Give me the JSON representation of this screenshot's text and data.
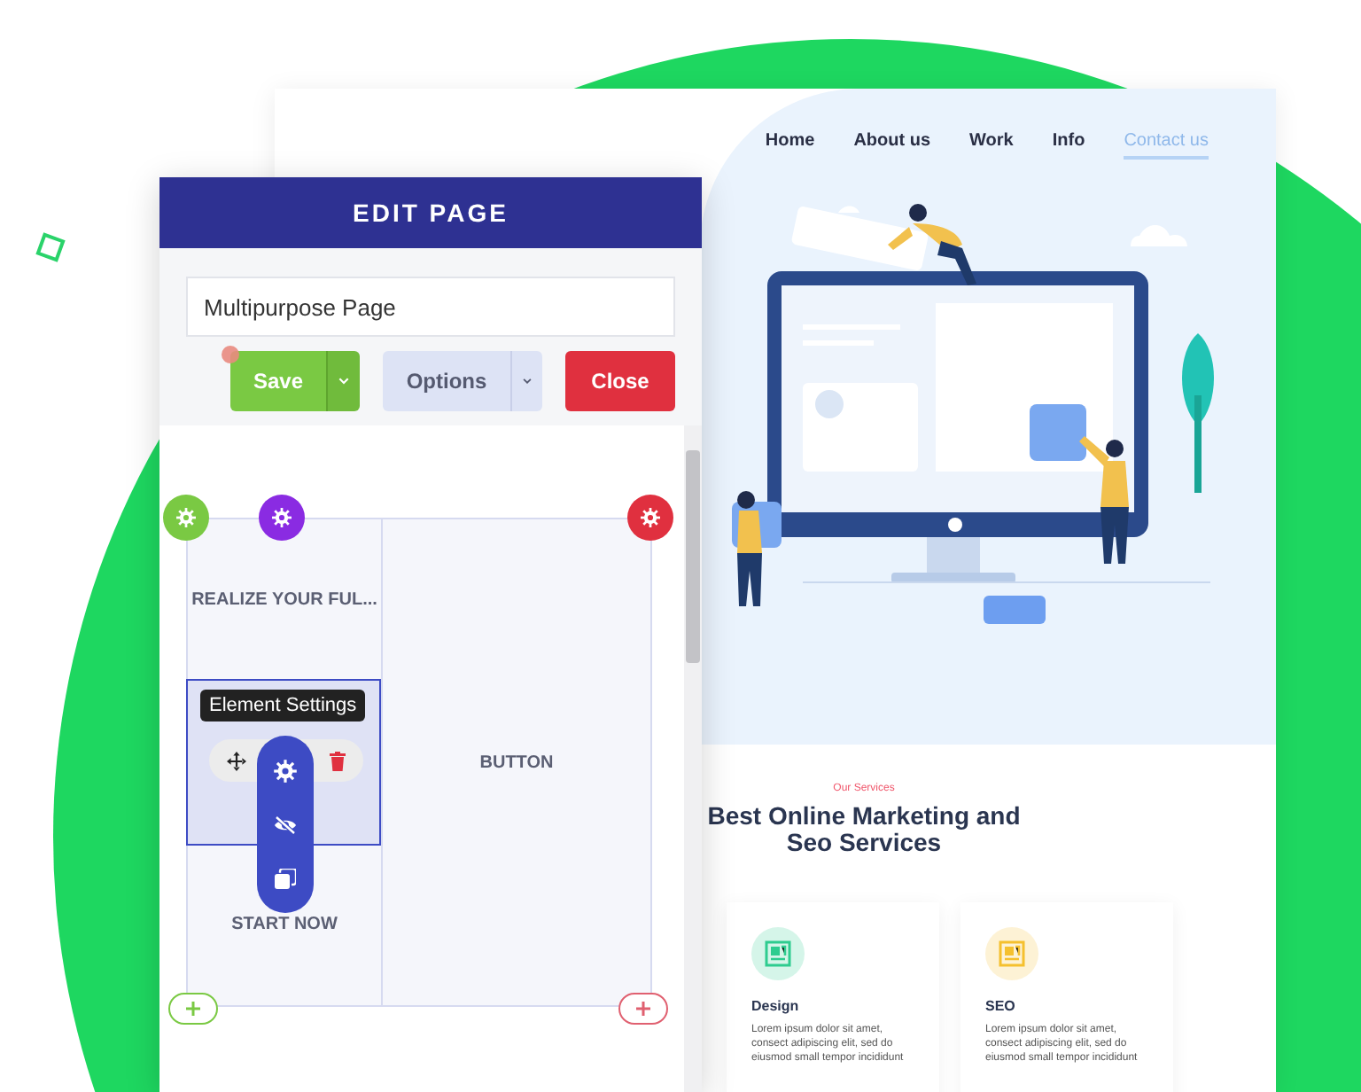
{
  "edit_panel": {
    "title": "EDIT PAGE",
    "page_name": "Multipurpose Page",
    "buttons": [
      {
        "label": "Save",
        "kind": "save",
        "dropdown": true
      },
      {
        "label": "Options",
        "kind": "options",
        "dropdown": true
      },
      {
        "label": "Close",
        "kind": "close",
        "dropdown": false
      }
    ],
    "columns": [
      {
        "items": [
          {
            "kind": "text",
            "text": "REALIZE YOUR FUL..."
          },
          {
            "kind": "selection",
            "tooltip": "Element Settings"
          },
          {
            "kind": "text",
            "text": "START NOW"
          }
        ]
      },
      {
        "items": [
          {
            "kind": "text",
            "text": "BUTTON"
          }
        ]
      }
    ]
  },
  "preview": {
    "nav": [
      {
        "label": "Home",
        "selected": false
      },
      {
        "label": "About us",
        "selected": false
      },
      {
        "label": "Work",
        "selected": false
      },
      {
        "label": "Info",
        "selected": false
      },
      {
        "label": "Contact us",
        "selected": true
      }
    ],
    "section_label": "Our Services",
    "section_title": "Best Online Marketing and Seo Services",
    "cards": [
      {
        "title": "Design",
        "text": "Lorem ipsum dolor sit amet, consect adipiscing elit, sed do eiusmod small tempor incididunt",
        "color": "#2ecc8f"
      },
      {
        "title": "SEO",
        "text": "Lorem ipsum dolor sit amet, consect adipiscing elit, sed do eiusmod small tempor incididunt",
        "color": "#f5c02e"
      }
    ]
  }
}
